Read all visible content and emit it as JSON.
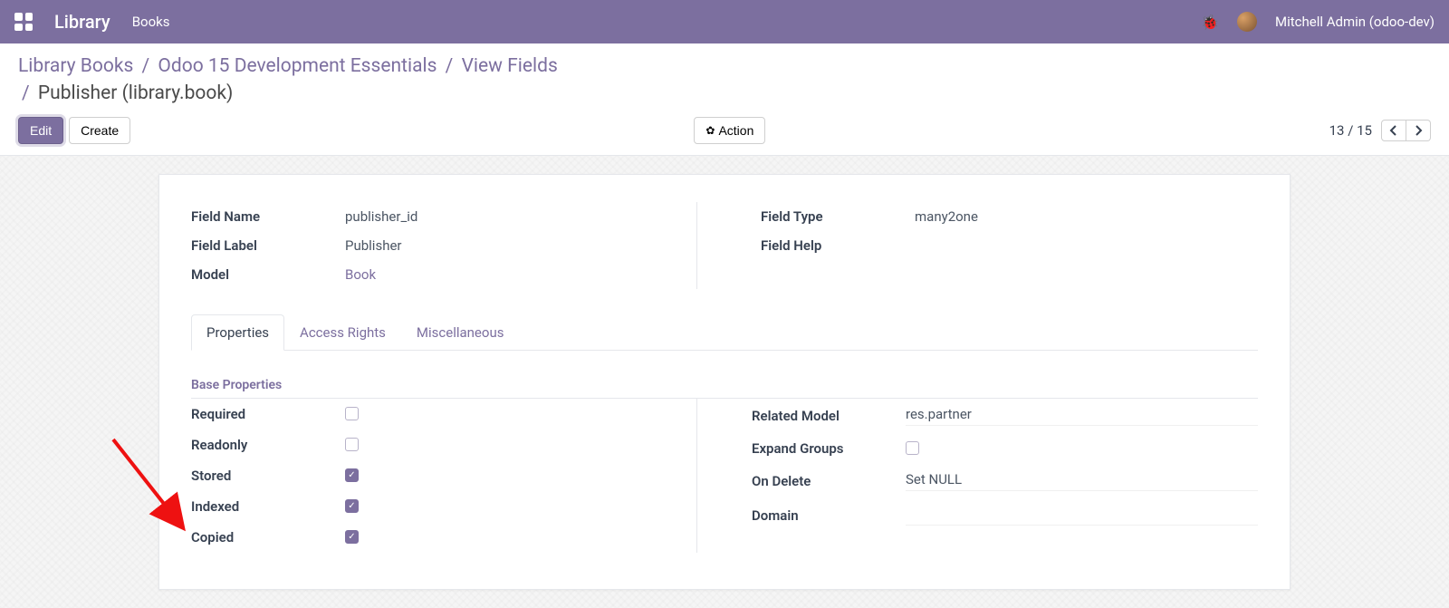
{
  "navbar": {
    "brand": "Library",
    "menu": "Books",
    "username": "Mitchell Admin (odoo-dev)"
  },
  "breadcrumb": {
    "segs": [
      "Library Books",
      "Odoo 15 Development Essentials",
      "View Fields"
    ],
    "current": "Publisher (library.book)"
  },
  "buttons": {
    "edit": "Edit",
    "create": "Create",
    "action": "Action"
  },
  "pager": {
    "pos": "13",
    "total": "15"
  },
  "fields": {
    "field_name_label": "Field Name",
    "field_name_value": "publisher_id",
    "field_label_label": "Field Label",
    "field_label_value": "Publisher",
    "model_label": "Model",
    "model_value": "Book",
    "field_type_label": "Field Type",
    "field_type_value": "many2one",
    "field_help_label": "Field Help",
    "field_help_value": ""
  },
  "tabs": {
    "properties": "Properties",
    "access": "Access Rights",
    "misc": "Miscellaneous"
  },
  "section": {
    "base_props": "Base Properties"
  },
  "props": {
    "required_label": "Required",
    "readonly_label": "Readonly",
    "stored_label": "Stored",
    "indexed_label": "Indexed",
    "copied_label": "Copied",
    "related_model_label": "Related Model",
    "related_model_value": "res.partner",
    "expand_groups_label": "Expand Groups",
    "on_delete_label": "On Delete",
    "on_delete_value": "Set NULL",
    "domain_label": "Domain",
    "domain_value": ""
  }
}
